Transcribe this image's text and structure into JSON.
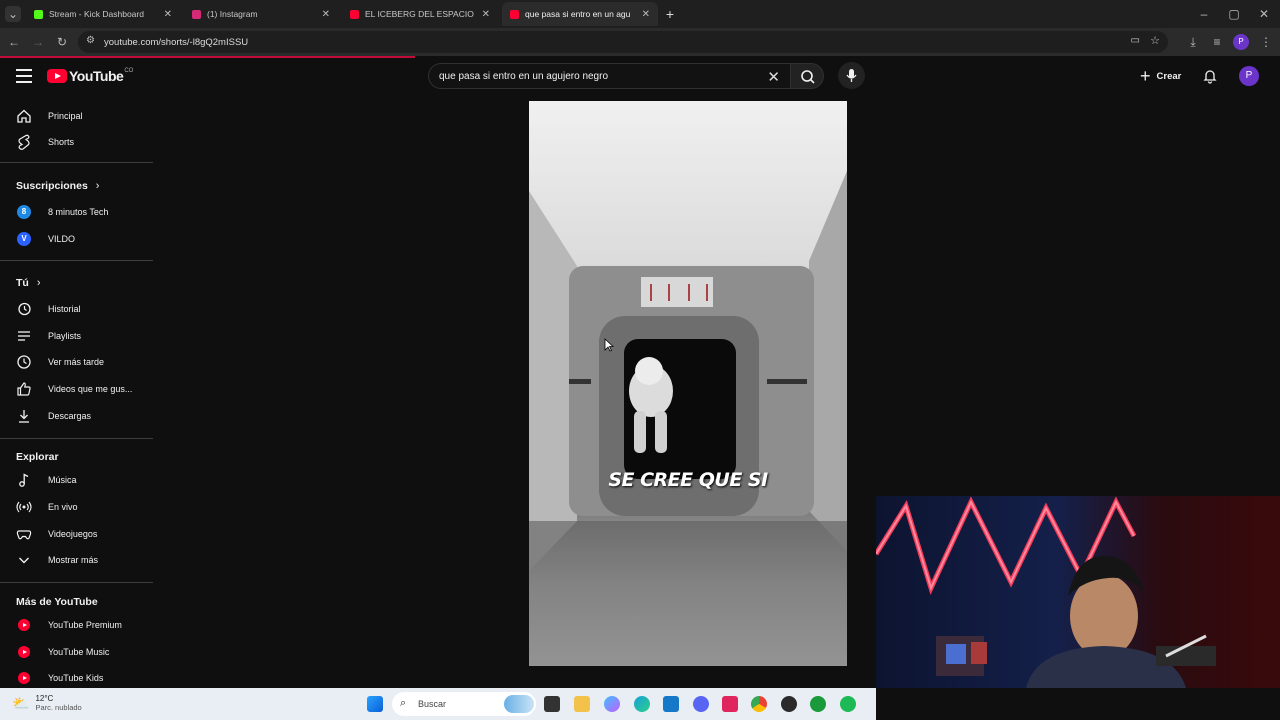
{
  "browser": {
    "tabs": [
      {
        "title": "Stream - Kick Dashboard",
        "favicon_color": "#53fc18"
      },
      {
        "title": "(1) Instagram",
        "favicon_color": "#d62976"
      },
      {
        "title": "EL ICEBERG DEL ESPACIO EXPLI",
        "favicon_color": "#ff0033"
      },
      {
        "title": "que pasa si entro en un agu",
        "favicon_color": "#ff0033"
      }
    ],
    "url": "youtube.com/shorts/-l8gQ2mISSU"
  },
  "youtube": {
    "logo_text": "YouTube",
    "logo_region": "CO",
    "search_query": "que pasa si entro en un agujero negro",
    "create_label": "Crear",
    "avatar_letter": "P"
  },
  "sidebar": {
    "top_items": [
      {
        "label": "Principal",
        "icon": "home-icon"
      },
      {
        "label": "Shorts",
        "icon": "shorts-icon"
      }
    ],
    "subscriptions_heading": "Suscripciones",
    "subscriptions": [
      {
        "label": "8 minutos Tech",
        "avatar_letter": "8",
        "avatar_color": "#1e88e5"
      },
      {
        "label": "VILDO",
        "avatar_letter": "V",
        "avatar_color": "#2962ff"
      }
    ],
    "you_heading": "Tú",
    "you_items": [
      {
        "label": "Historial",
        "icon": "history-icon"
      },
      {
        "label": "Playlists",
        "icon": "playlists-icon"
      },
      {
        "label": "Ver más tarde",
        "icon": "watch-later-icon"
      },
      {
        "label": "Videos que me gus...",
        "icon": "thumbs-up-icon"
      },
      {
        "label": "Descargas",
        "icon": "download-icon"
      }
    ],
    "explore_heading": "Explorar",
    "explore_items": [
      {
        "label": "Música",
        "icon": "music-icon"
      },
      {
        "label": "En vivo",
        "icon": "live-icon"
      },
      {
        "label": "Videojuegos",
        "icon": "gaming-icon"
      },
      {
        "label": "Mostrar más",
        "icon": "chevron-down-icon"
      }
    ],
    "more_heading": "Más de YouTube",
    "more_items": [
      {
        "label": "YouTube Premium"
      },
      {
        "label": "YouTube Music"
      },
      {
        "label": "YouTube Kids"
      }
    ]
  },
  "video": {
    "caption": "SE CREE QUE SI"
  },
  "taskbar": {
    "weather_temp": "12°C",
    "weather_desc": "Parc. nublado",
    "search_label": "Buscar"
  }
}
